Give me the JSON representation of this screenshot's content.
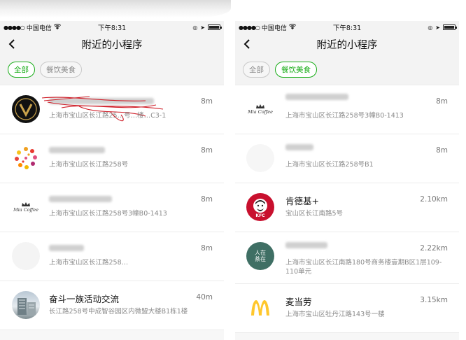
{
  "left": {
    "status": {
      "carrier": "中国电信",
      "time": "下午8:31"
    },
    "title": "附近的小程序",
    "tabs": [
      {
        "label": "全部",
        "active": true
      },
      {
        "label": "餐饮美食",
        "active": false
      }
    ],
    "items": [
      {
        "name": "",
        "addr": "上海市宝山区长江路25…号…楼…C3-1",
        "dist": "8m",
        "icon": "v-logo-icon"
      },
      {
        "name": "",
        "addr": "上海市宝山区长江路258号",
        "dist": "8m",
        "icon": "dot-ring-icon"
      },
      {
        "name": "",
        "addr": "上海市宝山区长江路258号3幢B0-1413",
        "dist": "8m",
        "icon": "crown-logo-icon",
        "logo_text": "Mia Coffee"
      },
      {
        "name": "",
        "addr": "上海市宝山区长江路258…",
        "dist": "8m",
        "icon": "blank-icon"
      },
      {
        "name": "奋斗一族活动交流",
        "addr": "长江路258号中成智谷园区内微盟大楼B1栋1楼",
        "dist": "40m",
        "icon": "building-photo-icon"
      }
    ]
  },
  "right": {
    "status": {
      "carrier": "中国电信",
      "time": "下午8:31"
    },
    "title": "附近的小程序",
    "tabs": [
      {
        "label": "全部",
        "active": false
      },
      {
        "label": "餐饮美食",
        "active": true
      }
    ],
    "items": [
      {
        "name": "",
        "addr": "上海市宝山区长江路258号3幢B0-1413",
        "dist": "8m",
        "icon": "crown-logo-icon",
        "logo_text": "Mia Coffee"
      },
      {
        "name": "",
        "addr": "上海市宝山区长江路258号B1",
        "dist": "8m",
        "icon": "blank-icon"
      },
      {
        "name": "肯德基+",
        "addr": "宝山区长江南路5号",
        "dist": "2.10km",
        "icon": "kfc-logo-icon",
        "logo_text": "KFC"
      },
      {
        "name": "",
        "addr": "上海市宝山区长江南路180号商务楼壹期B区1层109-110单元",
        "dist": "2.22km",
        "icon": "tea-logo-icon",
        "logo_text": "人在茶在"
      },
      {
        "name": "麦当劳",
        "addr": "上海市宝山区牡丹江路143号一楼",
        "dist": "3.15km",
        "icon": "mcdonalds-logo-icon"
      }
    ]
  },
  "colors": {
    "accent": "#1aad19",
    "kfc_red": "#c8102e",
    "tea_green": "#3f6f64",
    "mcd_yellow": "#ffc72c"
  }
}
